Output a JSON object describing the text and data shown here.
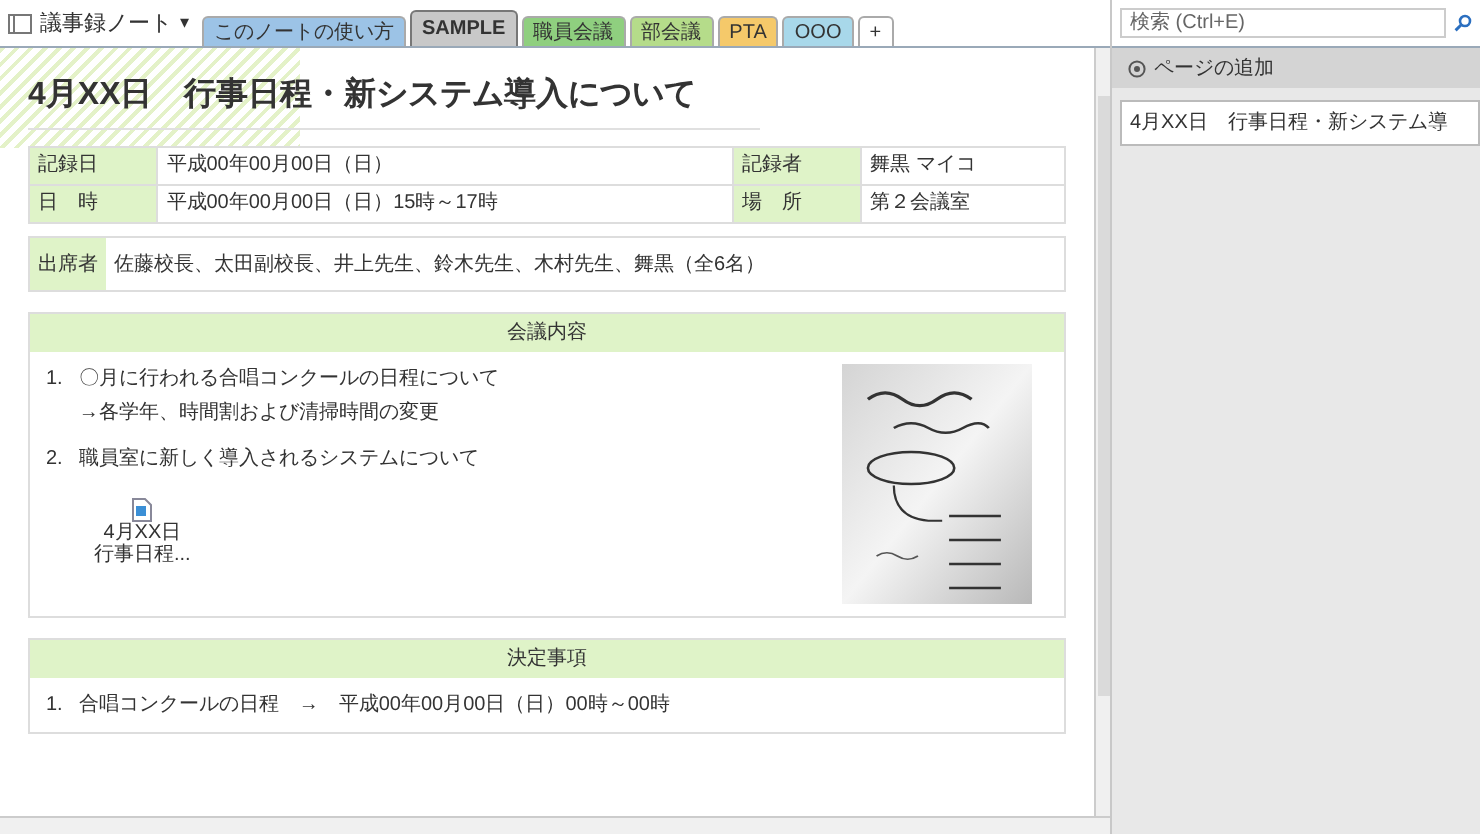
{
  "notebook": {
    "title": "議事録ノート",
    "caret": "▾"
  },
  "tabs": [
    {
      "label": "このノートの使い方",
      "color": "#9cc3e6",
      "selected": false
    },
    {
      "label": "SAMPLE",
      "color": "#c8c8c8",
      "selected": true
    },
    {
      "label": "職員会議",
      "color": "#8fcf7f",
      "selected": false
    },
    {
      "label": "部会議",
      "color": "#b5dc8a",
      "selected": false
    },
    {
      "label": "PTA",
      "color": "#f5c96a",
      "selected": false
    },
    {
      "label": "OOO",
      "color": "#a8d8ea",
      "selected": false
    },
    {
      "label": "+",
      "color": "#ffffff",
      "selected": false
    }
  ],
  "search": {
    "placeholder": "検索 (Ctrl+E)"
  },
  "page": {
    "title": "4月XX日　行事日程・新システム導入について",
    "info_rows": [
      [
        "記録日",
        "平成00年00月00日（日）",
        "記録者",
        "舞黒 マイコ"
      ],
      [
        "日　時",
        "平成00年00月00日（日）15時～17時",
        "場　所",
        "第２会議室"
      ]
    ],
    "attendees": {
      "label": "出席者",
      "value": "佐藤校長、太田副校長、井上先生、鈴木先生、木村先生、舞黒（全6名）"
    },
    "sections": [
      {
        "heading": "会議内容",
        "items": [
          {
            "kind": "item",
            "number": "1.",
            "lines": [
              "〇月に行われる合唱コンクールの日程について",
              "→各学年、時間割および清掃時間の変更"
            ]
          },
          {
            "kind": "item",
            "number": "2.",
            "lines": [
              "職員室に新しく導入されるシステムについて"
            ]
          },
          {
            "kind": "attachment",
            "lines": [
              "4月XX日",
              "行事日程..."
            ]
          }
        ],
        "picture": {
          "kind": "picture"
        }
      },
      {
        "heading": "決定事項",
        "items": [
          {
            "kind": "item",
            "number": "1.",
            "lines": [
              "合唱コンクールの日程　→　平成00年00月00日（日）00時～00時"
            ]
          }
        ]
      }
    ]
  },
  "sidebar": {
    "add_page": "ページの追加",
    "pages": [
      {
        "title": "4月XX日　行事日程・新システム導",
        "selected": true
      }
    ]
  }
}
